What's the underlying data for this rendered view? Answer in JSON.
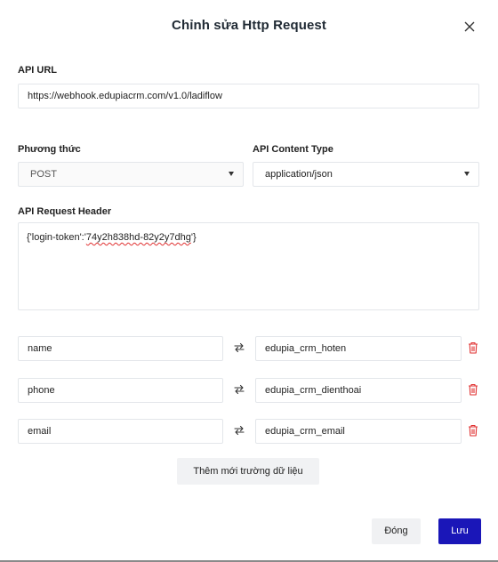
{
  "dialog": {
    "title": "Chỉnh sửa Http Request",
    "close_icon": "close-icon"
  },
  "api_url": {
    "label": "API URL",
    "value": "https://webhook.edupiacrm.com/v1.0/ladiflow"
  },
  "method": {
    "label": "Phương thức",
    "selected": "POST"
  },
  "content_type": {
    "label": "API Content Type",
    "selected": "application/json"
  },
  "request_header": {
    "label": "API Request Header",
    "prefix": "{'login-token':'",
    "token": "74y2h838hd-82y2y7dhg",
    "suffix": "'}"
  },
  "mappings": [
    {
      "source": "name",
      "target": "edupia_crm_hoten"
    },
    {
      "source": "phone",
      "target": "edupia_crm_dienthoai"
    },
    {
      "source": "email",
      "target": "edupia_crm_email"
    }
  ],
  "icons": {
    "swap": "swap-arrows-icon",
    "delete": "trash-icon",
    "dropdown": "caret-down-icon"
  },
  "colors": {
    "primary": "#1a16b8",
    "danger": "#e03131",
    "border": "#e3e6ea"
  },
  "buttons": {
    "add_field": "Thêm mới trường dữ liệu",
    "close": "Đóng",
    "save": "Lưu"
  }
}
